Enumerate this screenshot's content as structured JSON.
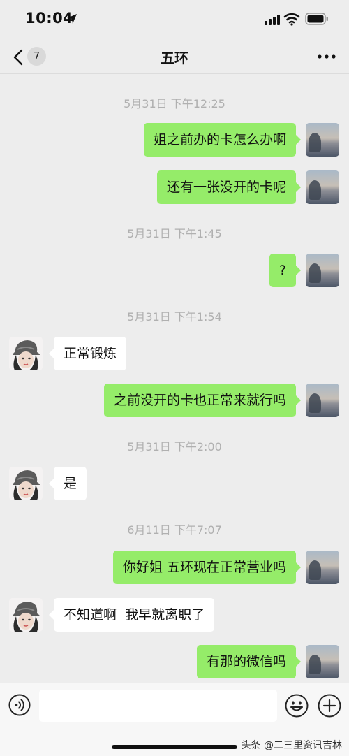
{
  "status_bar": {
    "time": "10:04"
  },
  "nav": {
    "unread_count": "7",
    "title": "五环"
  },
  "messages": [
    {
      "type": "timestamp",
      "text": "5月31日 下午12:25"
    },
    {
      "type": "out",
      "text": "姐之前办的卡怎么办啊"
    },
    {
      "type": "out",
      "text": "还有一张没开的卡呢"
    },
    {
      "type": "timestamp",
      "text": "5月31日 下午1:45"
    },
    {
      "type": "out",
      "text": "?"
    },
    {
      "type": "timestamp",
      "text": "5月31日 下午1:54"
    },
    {
      "type": "in",
      "text": "正常锻炼"
    },
    {
      "type": "out",
      "text": "之前没开的卡也正常来就行吗"
    },
    {
      "type": "timestamp",
      "text": "5月31日 下午2:00"
    },
    {
      "type": "in",
      "text": "是"
    },
    {
      "type": "timestamp",
      "text": "6月11日 下午7:07"
    },
    {
      "type": "out",
      "text": "你好姐 五环现在正常营业吗"
    },
    {
      "type": "in",
      "text": "不知道啊  我早就离职了"
    },
    {
      "type": "out",
      "text": "有那的微信吗"
    }
  ],
  "input": {
    "value": "",
    "placeholder": ""
  },
  "watermark": "头条 @二三里资讯吉林"
}
